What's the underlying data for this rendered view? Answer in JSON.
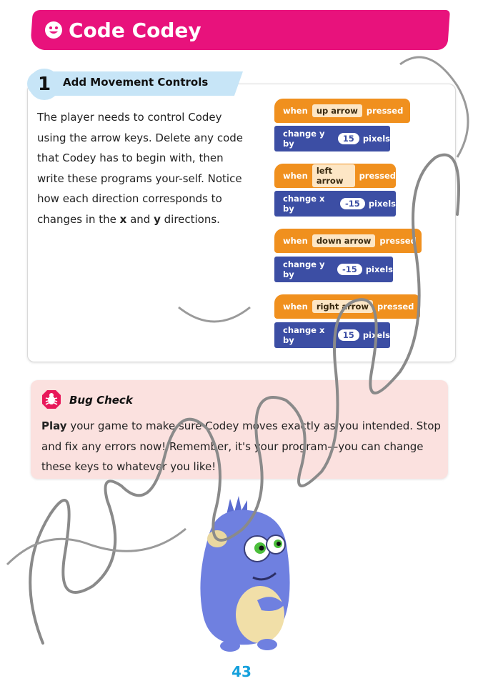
{
  "header": {
    "title": "Code Codey"
  },
  "step": {
    "number": "1",
    "title": "Add Movement Controls",
    "body_part1": "The player needs to control Codey using the arrow keys. Delete any code that Codey has to begin with, then write these programs your-self. Notice how each direction corresponds to changes in the ",
    "body_x": "x",
    "body_part2": " and ",
    "body_y": "y",
    "body_part3": " directions."
  },
  "code_blocks": [
    {
      "when": "when",
      "key": "up arrow",
      "pressed": "pressed",
      "action": "change y by",
      "value": "15",
      "unit": "pixels"
    },
    {
      "when": "when",
      "key": "left arrow",
      "pressed": "pressed",
      "action": "change x by",
      "value": "-15",
      "unit": "pixels"
    },
    {
      "when": "when",
      "key": "down arrow",
      "pressed": "pressed",
      "action": "change y by",
      "value": "-15",
      "unit": "pixels"
    },
    {
      "when": "when",
      "key": "right arrow",
      "pressed": "pressed",
      "action": "change x by",
      "value": "15",
      "unit": "pixels"
    }
  ],
  "bug_check": {
    "title": "Bug Check",
    "body_bold": "Play",
    "body_rest": " your game to make sure Codey moves exactly as you intended. Stop and fix any errors now! Remember, it's your program—you can change these keys to whatever you like!"
  },
  "footer": {
    "page_number": "43"
  },
  "colors": {
    "banner": "#e8127c",
    "step_tab": "#c7e5f7",
    "event_block": "#f0901e",
    "motion_block": "#3c4ea4",
    "bug_panel": "#fbe1df",
    "page_number": "#14a0dc"
  }
}
